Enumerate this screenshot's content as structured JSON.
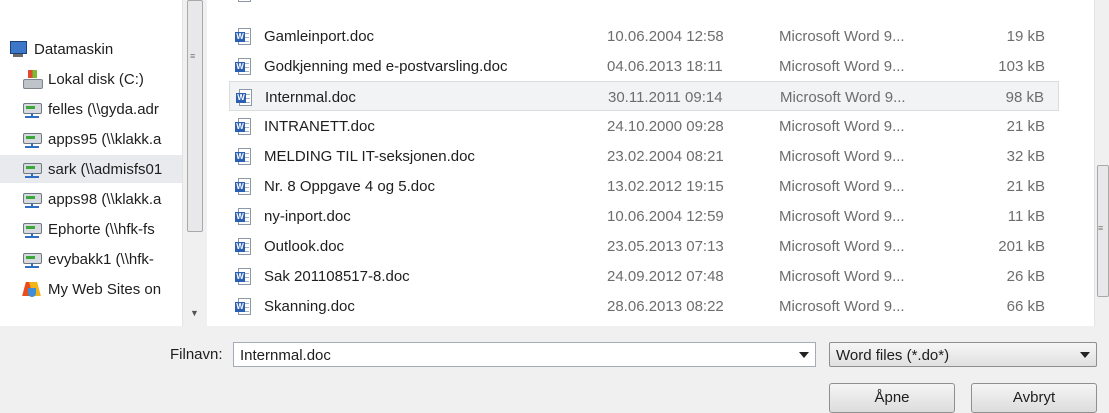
{
  "nav": {
    "items": [
      {
        "label": "Datamaskin",
        "icon": "computer-icon"
      },
      {
        "label": "Lokal disk (C:)",
        "icon": "local-disk-icon"
      },
      {
        "label": "felles (\\\\gyda.adr",
        "icon": "network-drive-icon"
      },
      {
        "label": "apps95 (\\\\klakk.a",
        "icon": "network-drive-icon"
      },
      {
        "label": "sark (\\\\admisfs01",
        "icon": "network-drive-icon",
        "selected": true
      },
      {
        "label": "apps98 (\\\\klakk.a",
        "icon": "network-drive-icon"
      },
      {
        "label": "Ephorte (\\\\hfk-fs",
        "icon": "network-drive-icon"
      },
      {
        "label": "evybakk1 (\\\\hfk-",
        "icon": "network-drive-icon"
      },
      {
        "label": "My Web Sites on",
        "icon": "web-sites-icon"
      }
    ]
  },
  "files": {
    "rows": [
      {
        "name": "Gamleinport.doc",
        "date": "10.06.2004 12:58",
        "type": "Microsoft Word 9...",
        "size": "19 kB"
      },
      {
        "name": "Godkjenning med e-postvarsling.doc",
        "date": "04.06.2013 18:11",
        "type": "Microsoft Word 9...",
        "size": "103 kB"
      },
      {
        "name": "Internmal.doc",
        "date": "30.11.2011 09:14",
        "type": "Microsoft Word 9...",
        "size": "98 kB",
        "selected": true
      },
      {
        "name": "INTRANETT.doc",
        "date": "24.10.2000 09:28",
        "type": "Microsoft Word 9...",
        "size": "21 kB"
      },
      {
        "name": "MELDING TIL IT-seksjonen.doc",
        "date": "23.02.2004 08:21",
        "type": "Microsoft Word 9...",
        "size": "32 kB"
      },
      {
        "name": "Nr. 8 Oppgave 4 og 5.doc",
        "date": "13.02.2012 19:15",
        "type": "Microsoft Word 9...",
        "size": "21 kB"
      },
      {
        "name": "ny-inport.doc",
        "date": "10.06.2004 12:59",
        "type": "Microsoft Word 9...",
        "size": "11 kB"
      },
      {
        "name": "Outlook.doc",
        "date": "23.05.2013 07:13",
        "type": "Microsoft Word 9...",
        "size": "201 kB"
      },
      {
        "name": "Sak 201108517-8.doc",
        "date": "24.09.2012 07:48",
        "type": "Microsoft Word 9...",
        "size": "26 kB"
      },
      {
        "name": "Skanning.doc",
        "date": "28.06.2013 08:22",
        "type": "Microsoft Word 9...",
        "size": "66 kB"
      }
    ]
  },
  "footer": {
    "filename_label": "Filnavn:",
    "filename_value": "Internmal.doc",
    "filetype_value": "Word files (*.do*)",
    "open_label": "Åpne",
    "cancel_label": "Avbryt"
  },
  "colors": {
    "selection": "#e8eaed",
    "word_icon": "#2b5fb3"
  }
}
